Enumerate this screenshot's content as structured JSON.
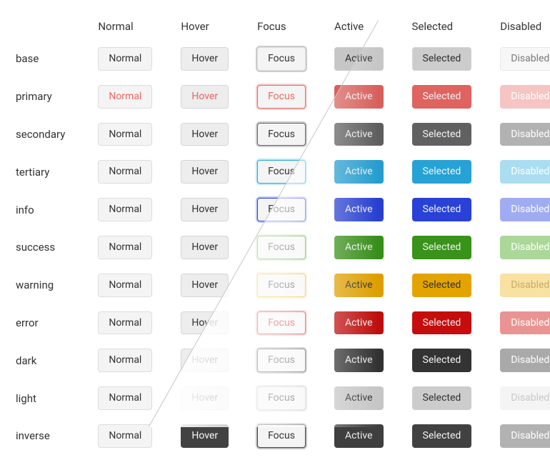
{
  "columns": [
    "Normal",
    "Hover",
    "Focus",
    "Active",
    "Selected",
    "Disabled"
  ],
  "variants": [
    {
      "key": "base",
      "label": "base"
    },
    {
      "key": "primary",
      "label": "primary"
    },
    {
      "key": "secondary",
      "label": "secondary"
    },
    {
      "key": "tertiary",
      "label": "tertiary"
    },
    {
      "key": "info",
      "label": "info"
    },
    {
      "key": "success",
      "label": "success"
    },
    {
      "key": "warning",
      "label": "warning"
    },
    {
      "key": "error",
      "label": "error"
    },
    {
      "key": "dark",
      "label": "dark"
    },
    {
      "key": "light",
      "label": "light"
    },
    {
      "key": "inverse",
      "label": "inverse"
    }
  ],
  "states": [
    {
      "key": "normal",
      "label": "Normal",
      "interactable": true
    },
    {
      "key": "hover",
      "label": "Hover",
      "interactable": true
    },
    {
      "key": "focus",
      "label": "Focus",
      "interactable": true
    },
    {
      "key": "active",
      "label": "Active",
      "interactable": true
    },
    {
      "key": "selected",
      "label": "Selected",
      "interactable": true
    },
    {
      "key": "disabled",
      "label": "Disabled",
      "interactable": false
    }
  ]
}
